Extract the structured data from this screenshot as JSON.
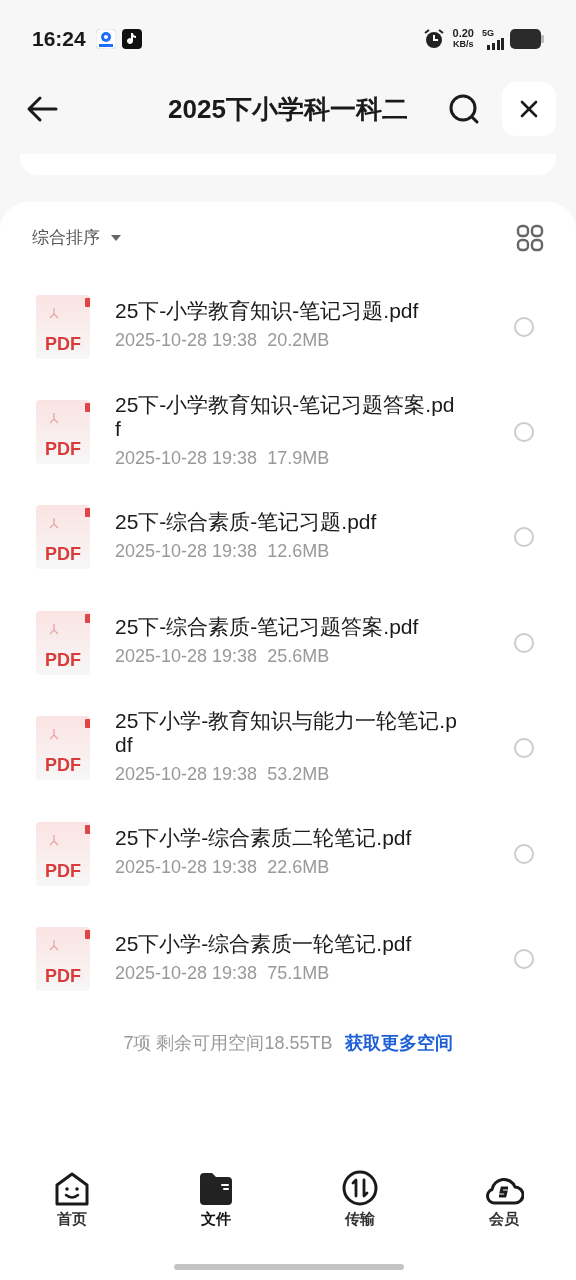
{
  "status_bar": {
    "time": "16:24",
    "net_speed": "0.20",
    "net_unit": "KB/s",
    "network": "5G"
  },
  "header": {
    "title": "2025下小学科一科二"
  },
  "sort": {
    "label": "综合排序"
  },
  "files": [
    {
      "name": "25下-小学教育知识-笔记习题.pdf",
      "date": "2025-10-28 19:38",
      "size": "20.2MB",
      "badge": "PDF",
      "checked": false
    },
    {
      "name": "25下-小学教育知识-笔记习题答案.pdf",
      "date": "2025-10-28 19:38",
      "size": "17.9MB",
      "badge": "PDF",
      "checked": false
    },
    {
      "name": "25下-综合素质-笔记习题.pdf",
      "date": "2025-10-28 19:38",
      "size": "12.6MB",
      "badge": "PDF",
      "checked": false
    },
    {
      "name": "25下-综合素质-笔记习题答案.pdf",
      "date": "2025-10-28 19:38",
      "size": "25.6MB",
      "badge": "PDF",
      "checked": false
    },
    {
      "name": "25下小学-教育知识与能力一轮笔记.pdf",
      "date": "2025-10-28 19:38",
      "size": "53.2MB",
      "badge": "PDF",
      "checked": false
    },
    {
      "name": "25下小学-综合素质二轮笔记.pdf",
      "date": "2025-10-28 19:38",
      "size": "22.6MB",
      "badge": "PDF",
      "checked": false
    },
    {
      "name": "25下小学-综合素质一轮笔记.pdf",
      "date": "2025-10-28 19:38",
      "size": "75.1MB",
      "badge": "PDF",
      "checked": false
    }
  ],
  "footer": {
    "summary": "7项 剩余可用空间18.55TB",
    "link": "获取更多空间"
  },
  "bottom_nav": [
    {
      "label": "首页",
      "kind": "home",
      "selected": false
    },
    {
      "label": "文件",
      "kind": "files",
      "selected": true
    },
    {
      "label": "传输",
      "kind": "transfer",
      "selected": false
    },
    {
      "label": "会员",
      "kind": "member",
      "selected": false
    }
  ]
}
